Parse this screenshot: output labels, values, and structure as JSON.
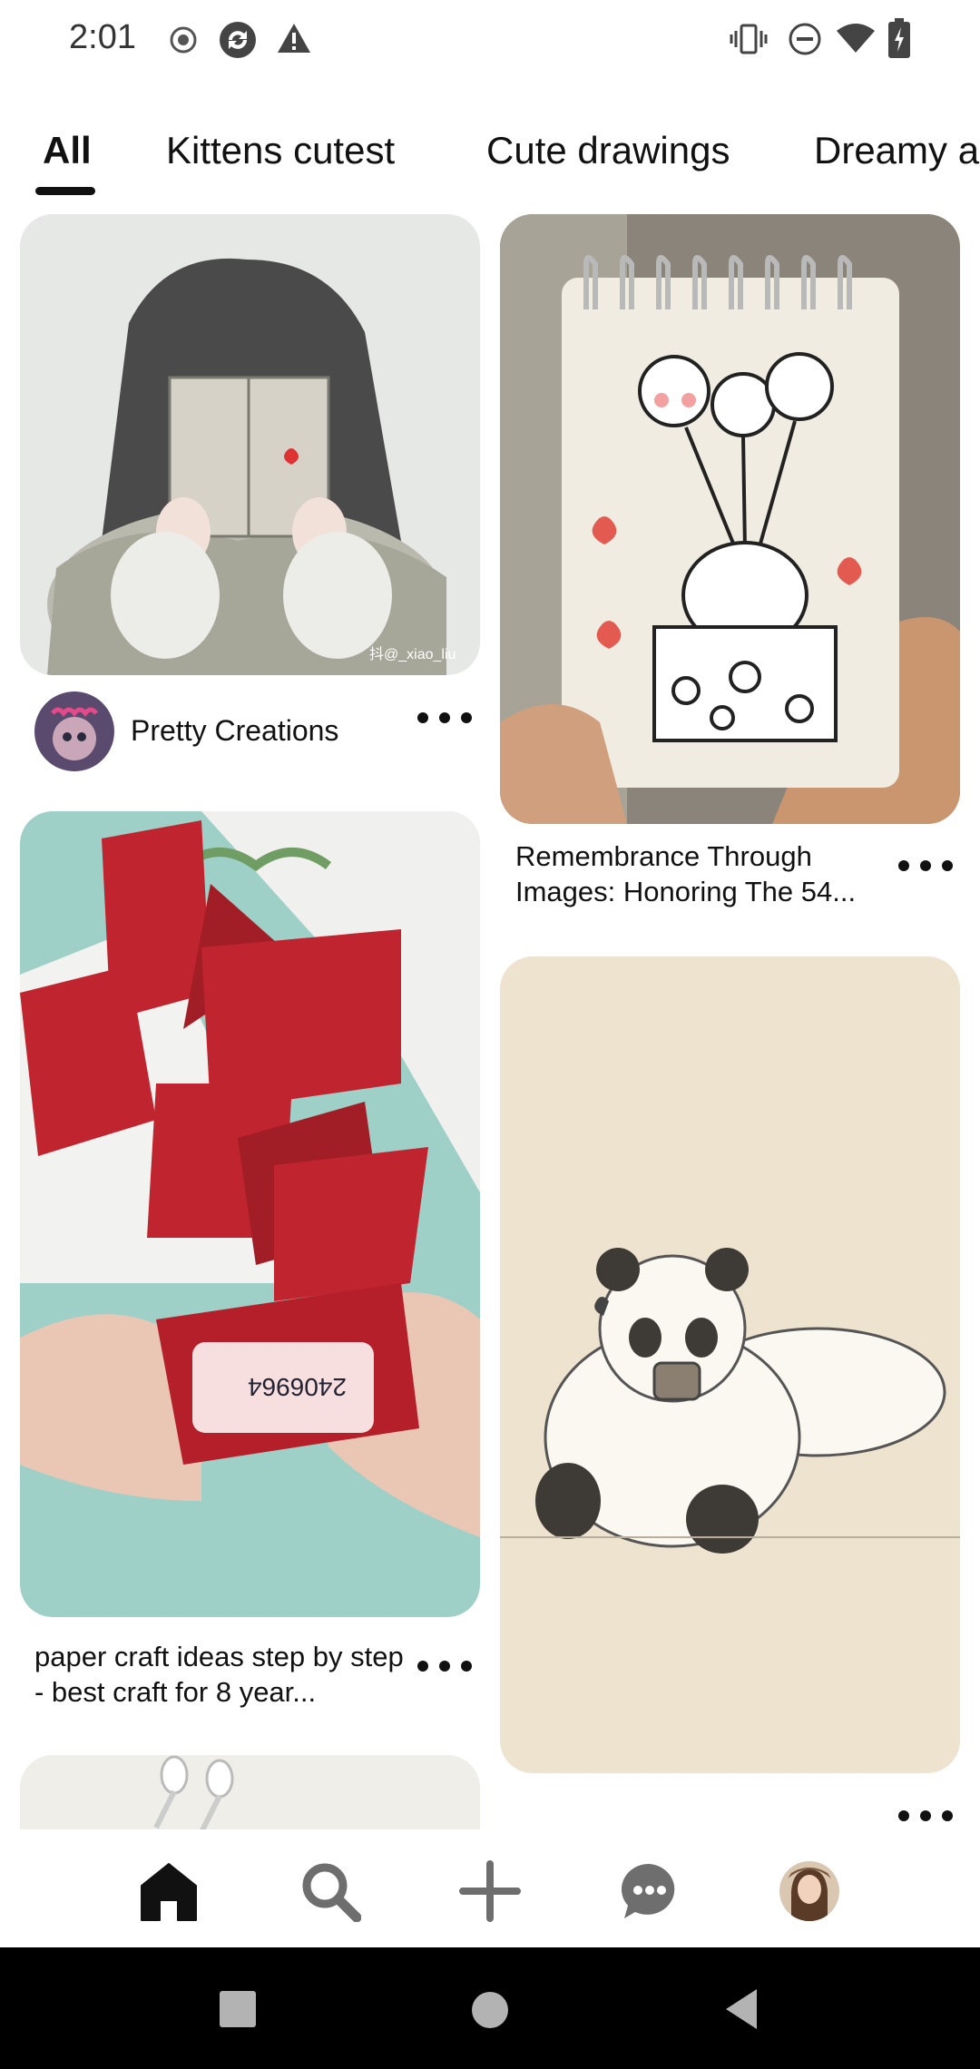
{
  "status_bar": {
    "time": "2:01"
  },
  "tabs": [
    {
      "label": "All"
    },
    {
      "label": "Kittens cutest"
    },
    {
      "label": "Cute drawings"
    },
    {
      "label": "Dreamy a"
    }
  ],
  "pins": {
    "left1": {
      "creator": "Pretty Creations",
      "watermark": "抖@_xiao_liu"
    },
    "right1": {
      "title": "Remembrance Through Images: Honoring The 54..."
    },
    "left2": {
      "title": "paper craft ideas step by step - best craft for 8 year..."
    }
  },
  "colors": {
    "accent": "#111111",
    "background": "#ffffff",
    "panda_bg": "#ede3cf"
  },
  "icons": {
    "nav": [
      "home-icon",
      "search-icon",
      "plus-icon",
      "chat-icon",
      "profile-avatar"
    ],
    "status": [
      "record-icon",
      "sync-icon",
      "warning-icon",
      "vibrate-icon",
      "dnd-icon",
      "wifi-icon",
      "battery-icon"
    ]
  }
}
